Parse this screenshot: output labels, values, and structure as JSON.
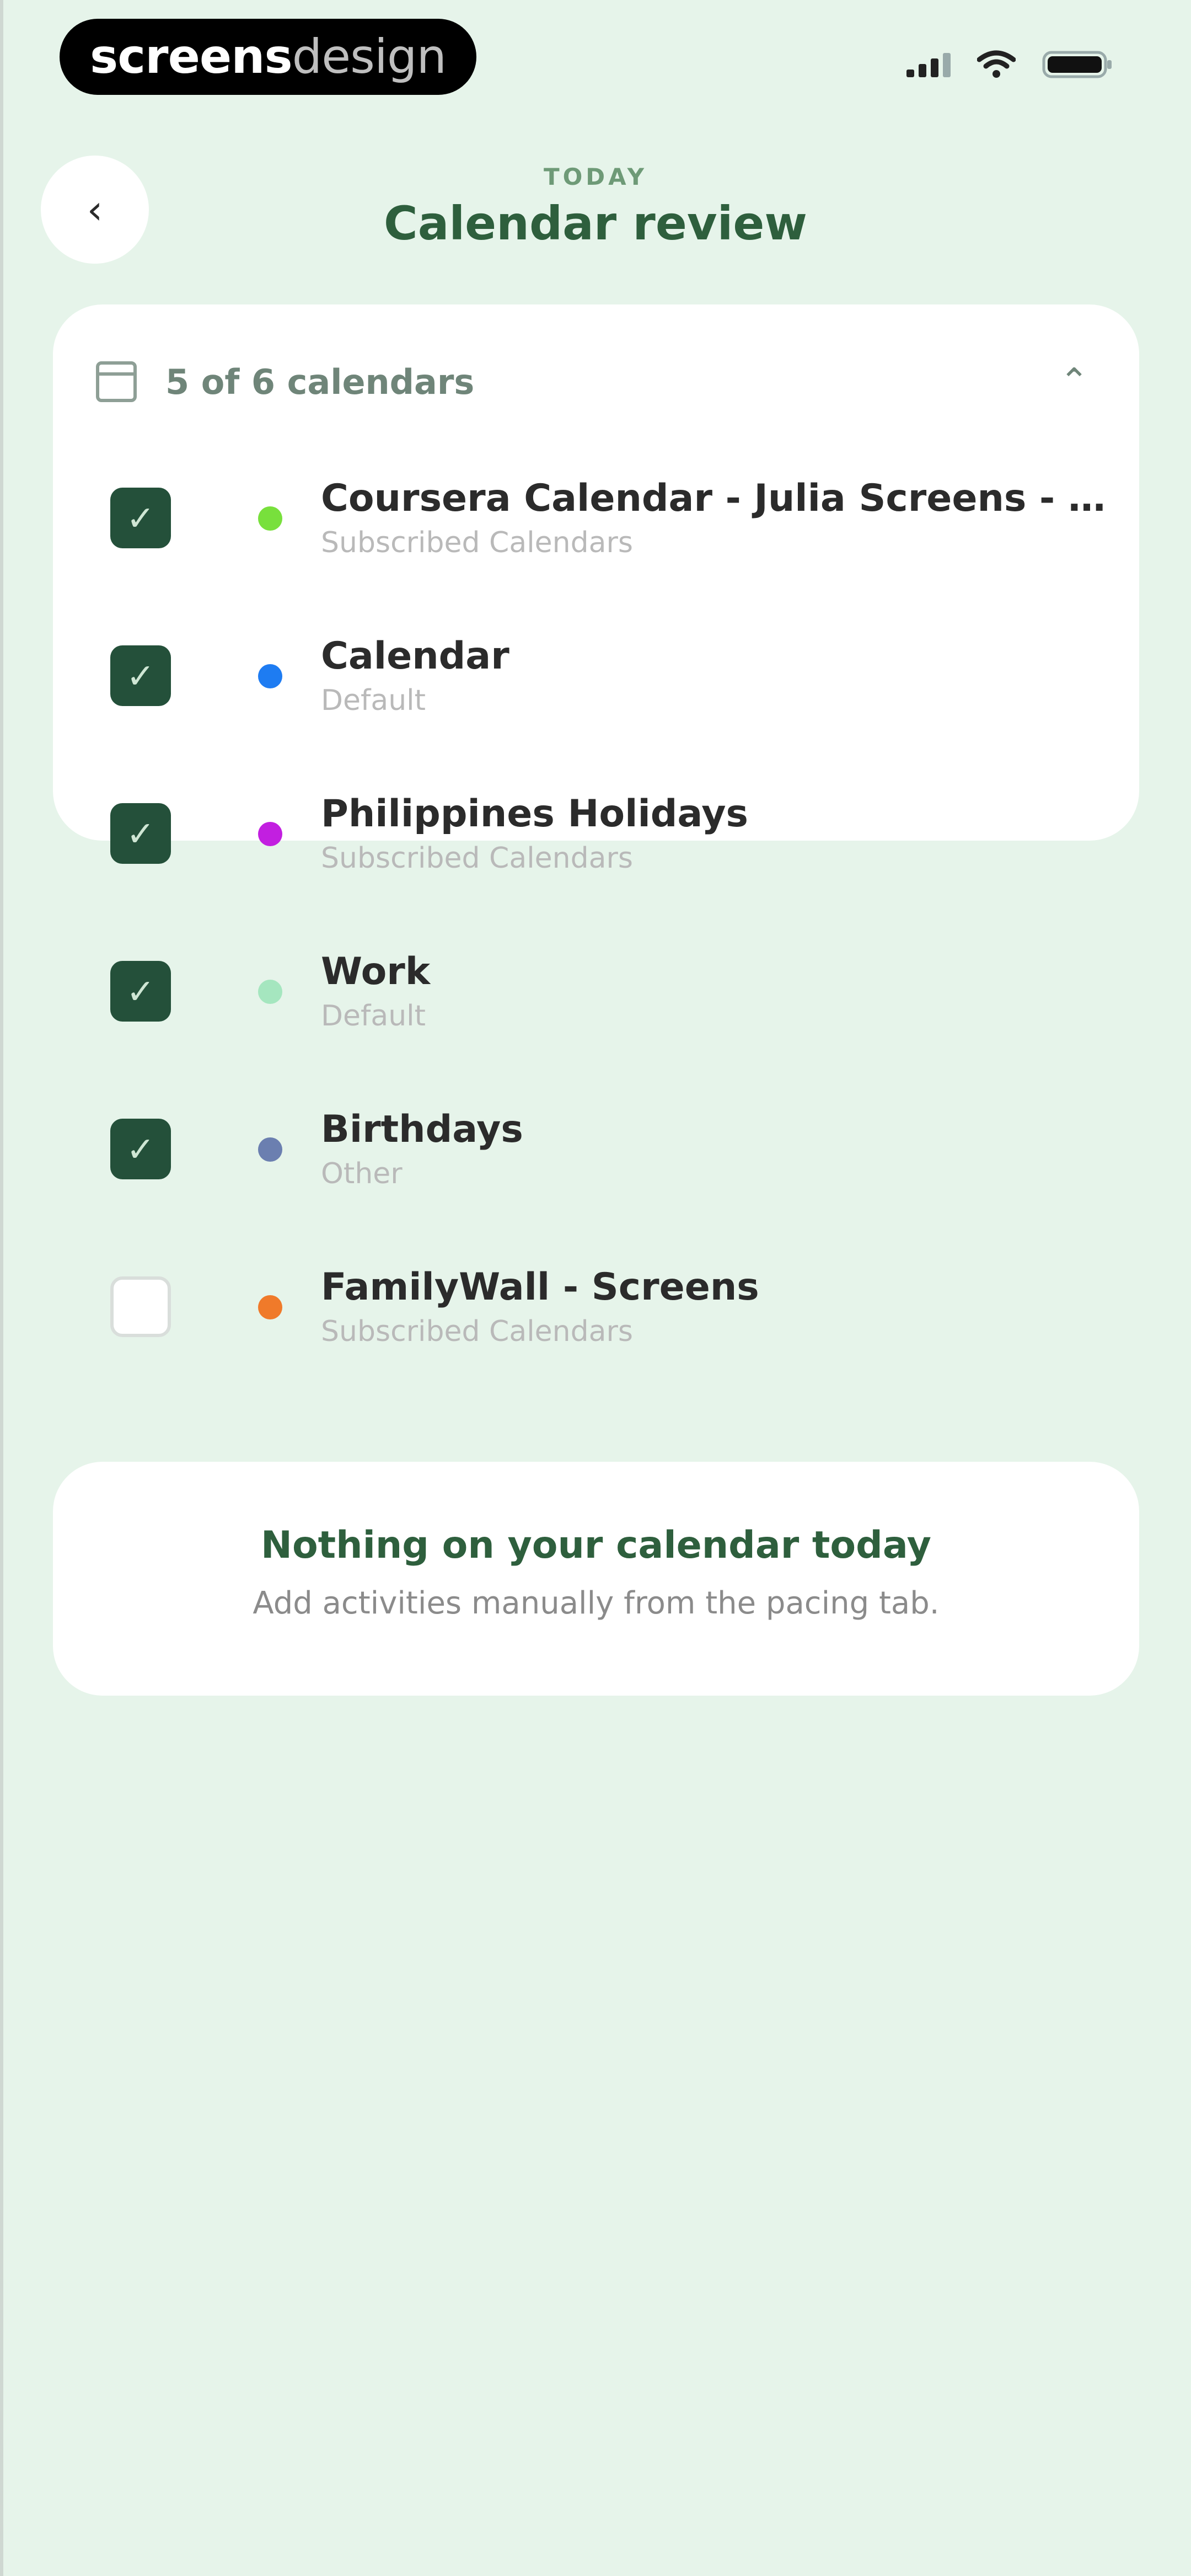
{
  "status_bar": {
    "brand_bold": "screens",
    "brand_light": "design"
  },
  "header": {
    "back_glyph": "‹",
    "eyebrow": "TODAY",
    "title": "Calendar review"
  },
  "calendars": {
    "count_label": "5 of 6 calendars",
    "collapse_glyph": "⌃",
    "items": [
      {
        "name": "Coursera Calendar - Julia Screens - scree...",
        "type": "Subscribed Calendars",
        "checked": true,
        "color": "#78e03c"
      },
      {
        "name": "Calendar",
        "type": "Default",
        "checked": true,
        "color": "#1e7cf2"
      },
      {
        "name": "Philippines Holidays",
        "type": "Subscribed Calendars",
        "checked": true,
        "color": "#c21fe0"
      },
      {
        "name": "Work",
        "type": "Default",
        "checked": true,
        "color": "#a5e6bf"
      },
      {
        "name": "Birthdays",
        "type": "Other",
        "checked": true,
        "color": "#6b7fb0"
      },
      {
        "name": "FamilyWall - Screens",
        "type": "Subscribed Calendars",
        "checked": false,
        "color": "#f07a2a"
      }
    ]
  },
  "empty_state": {
    "title": "Nothing on your calendar today",
    "subtitle": "Add activities manually from the pacing tab."
  },
  "colors": {
    "background": "#e6f4ea",
    "accent_dark_green": "#24503a",
    "title_green": "#2e5f3d"
  },
  "icons": {
    "signal": "signal-icon",
    "wifi": "wifi-icon",
    "battery": "battery-icon",
    "back": "chevron-left-icon",
    "calendar": "calendar-icon",
    "collapse": "chevron-up-icon",
    "check": "checkmark-icon"
  }
}
